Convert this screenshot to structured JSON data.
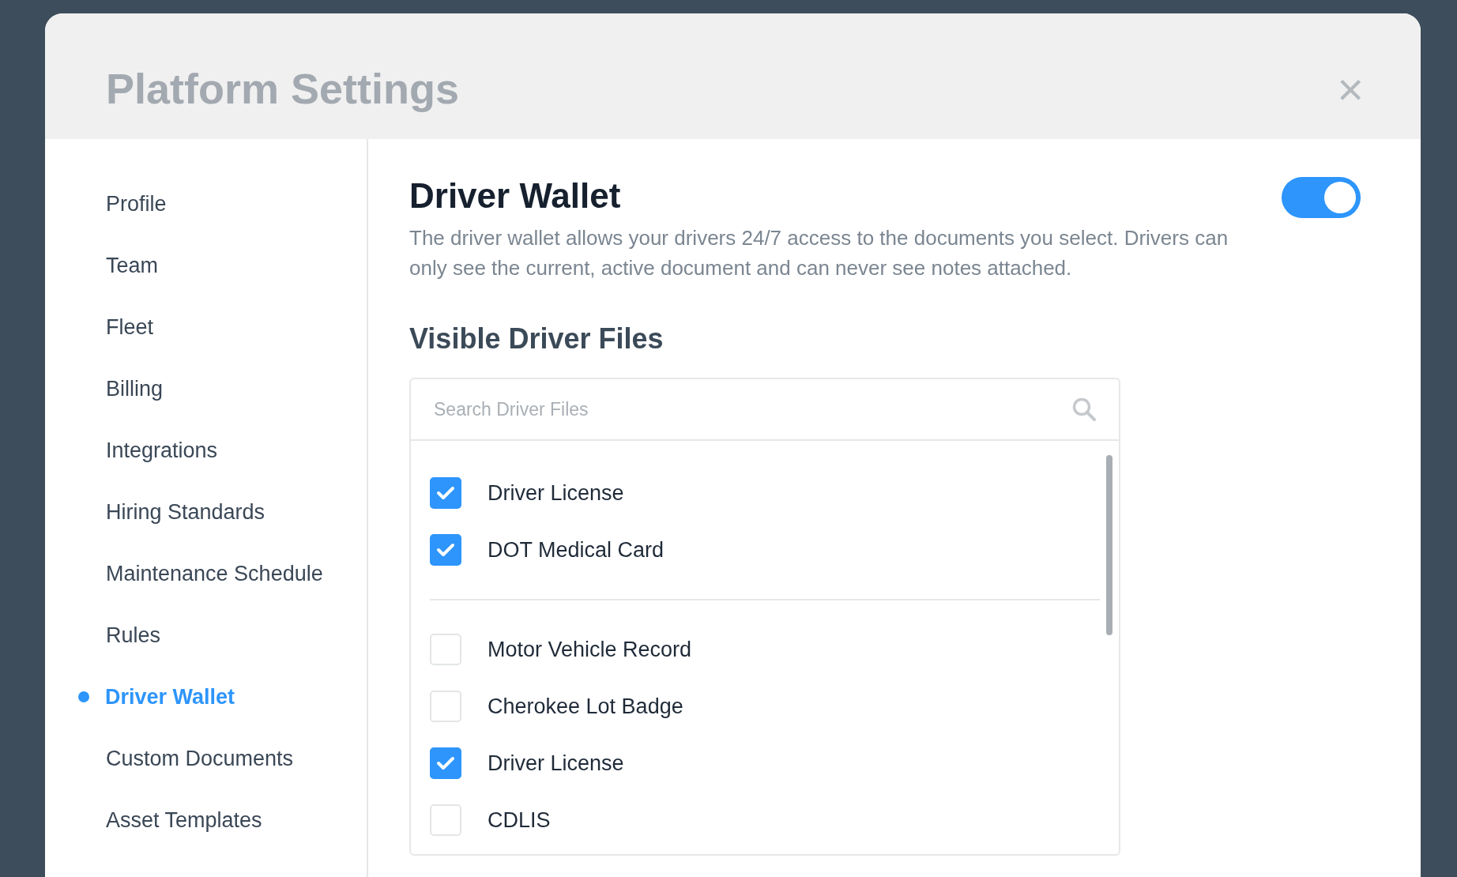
{
  "window": {
    "title": "Platform Settings",
    "close": "×"
  },
  "sidebar": {
    "items": [
      {
        "label": "Profile",
        "selected": false
      },
      {
        "label": "Team",
        "selected": false
      },
      {
        "label": "Fleet",
        "selected": false
      },
      {
        "label": "Billing",
        "selected": false
      },
      {
        "label": "Integrations",
        "selected": false
      },
      {
        "label": "Hiring Standards",
        "selected": false
      },
      {
        "label": "Maintenance Schedule",
        "selected": false
      },
      {
        "label": "Rules",
        "selected": false
      },
      {
        "label": "Driver Wallet",
        "selected": true
      },
      {
        "label": "Custom Documents",
        "selected": false
      },
      {
        "label": "Asset Templates",
        "selected": false
      }
    ]
  },
  "section": {
    "title": "Driver Wallet",
    "on": true,
    "description": "The driver wallet allows your drivers 24/7 access to the documents you select. Drivers can only see the current, active document and can never see notes attached."
  },
  "files": {
    "title": "Visible Driver Files",
    "search": {
      "placeholder": "Search Driver Files"
    },
    "groups": [
      [
        {
          "label": "Driver License",
          "checked": true
        },
        {
          "label": "DOT Medical Card",
          "checked": true
        }
      ],
      [
        {
          "label": "Motor Vehicle Record",
          "checked": false
        },
        {
          "label": "Cherokee Lot Badge",
          "checked": false
        },
        {
          "label": "Driver License",
          "checked": true
        },
        {
          "label": "CDLIS",
          "checked": false
        }
      ]
    ]
  }
}
